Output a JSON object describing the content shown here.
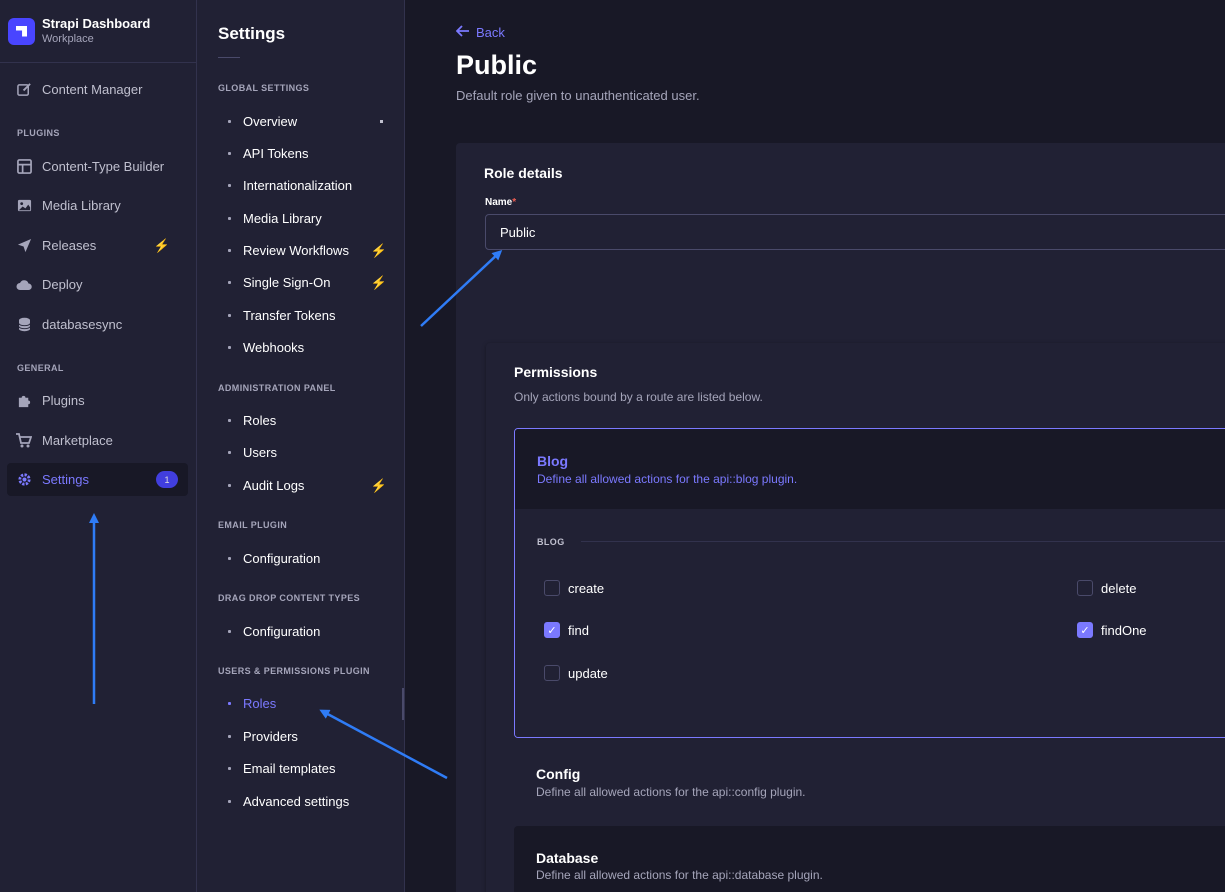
{
  "brand": {
    "title": "Strapi Dashboard",
    "subtitle": "Workplace"
  },
  "mainnav": {
    "content_manager": "Content Manager",
    "plugins_section": "PLUGINS",
    "plugins": [
      "Content-Type Builder",
      "Media Library",
      "Releases",
      "Deploy",
      "databasesync"
    ],
    "general_section": "GENERAL",
    "general": [
      "Plugins",
      "Marketplace",
      "Settings"
    ],
    "settings_badge": "1"
  },
  "subnav": {
    "title": "Settings",
    "global_section": "GLOBAL SETTINGS",
    "global": [
      "Overview",
      "API Tokens",
      "Internationalization",
      "Media Library",
      "Review Workflows",
      "Single Sign-On",
      "Transfer Tokens",
      "Webhooks"
    ],
    "admin_section": "ADMINISTRATION PANEL",
    "admin": [
      "Roles",
      "Users",
      "Audit Logs"
    ],
    "email_section": "EMAIL PLUGIN",
    "email": [
      "Configuration"
    ],
    "dragdrop_section": "DRAG DROP CONTENT TYPES",
    "dragdrop": [
      "Configuration"
    ],
    "users_section": "USERS & PERMISSIONS PLUGIN",
    "users": [
      "Roles",
      "Providers",
      "Email templates",
      "Advanced settings"
    ]
  },
  "page": {
    "back": "Back",
    "title": "Public",
    "subtitle": "Default role given to unauthenticated user."
  },
  "role_details": {
    "heading": "Role details",
    "name_label": "Name",
    "required_mark": "*",
    "name_value": "Public"
  },
  "permissions": {
    "heading": "Permissions",
    "subtitle": "Only actions bound by a route are listed below.",
    "blog": {
      "title": "Blog",
      "description": "Define all allowed actions for the api::blog plugin.",
      "group_label": "BLOG",
      "actions": [
        {
          "label": "create",
          "checked": false
        },
        {
          "label": "delete",
          "checked": false
        },
        {
          "label": "find",
          "checked": true
        },
        {
          "label": "findOne",
          "checked": true
        },
        {
          "label": "update",
          "checked": false
        }
      ]
    },
    "config": {
      "title": "Config",
      "description": "Define all allowed actions for the api::config plugin."
    },
    "database": {
      "title": "Database",
      "description": "Define all allowed actions for the api::database plugin."
    }
  },
  "colors": {
    "accent": "#7b79ff",
    "primary": "#4945ff",
    "bolt": "#f29d41",
    "annotation_arrow": "#2f7cf6"
  }
}
